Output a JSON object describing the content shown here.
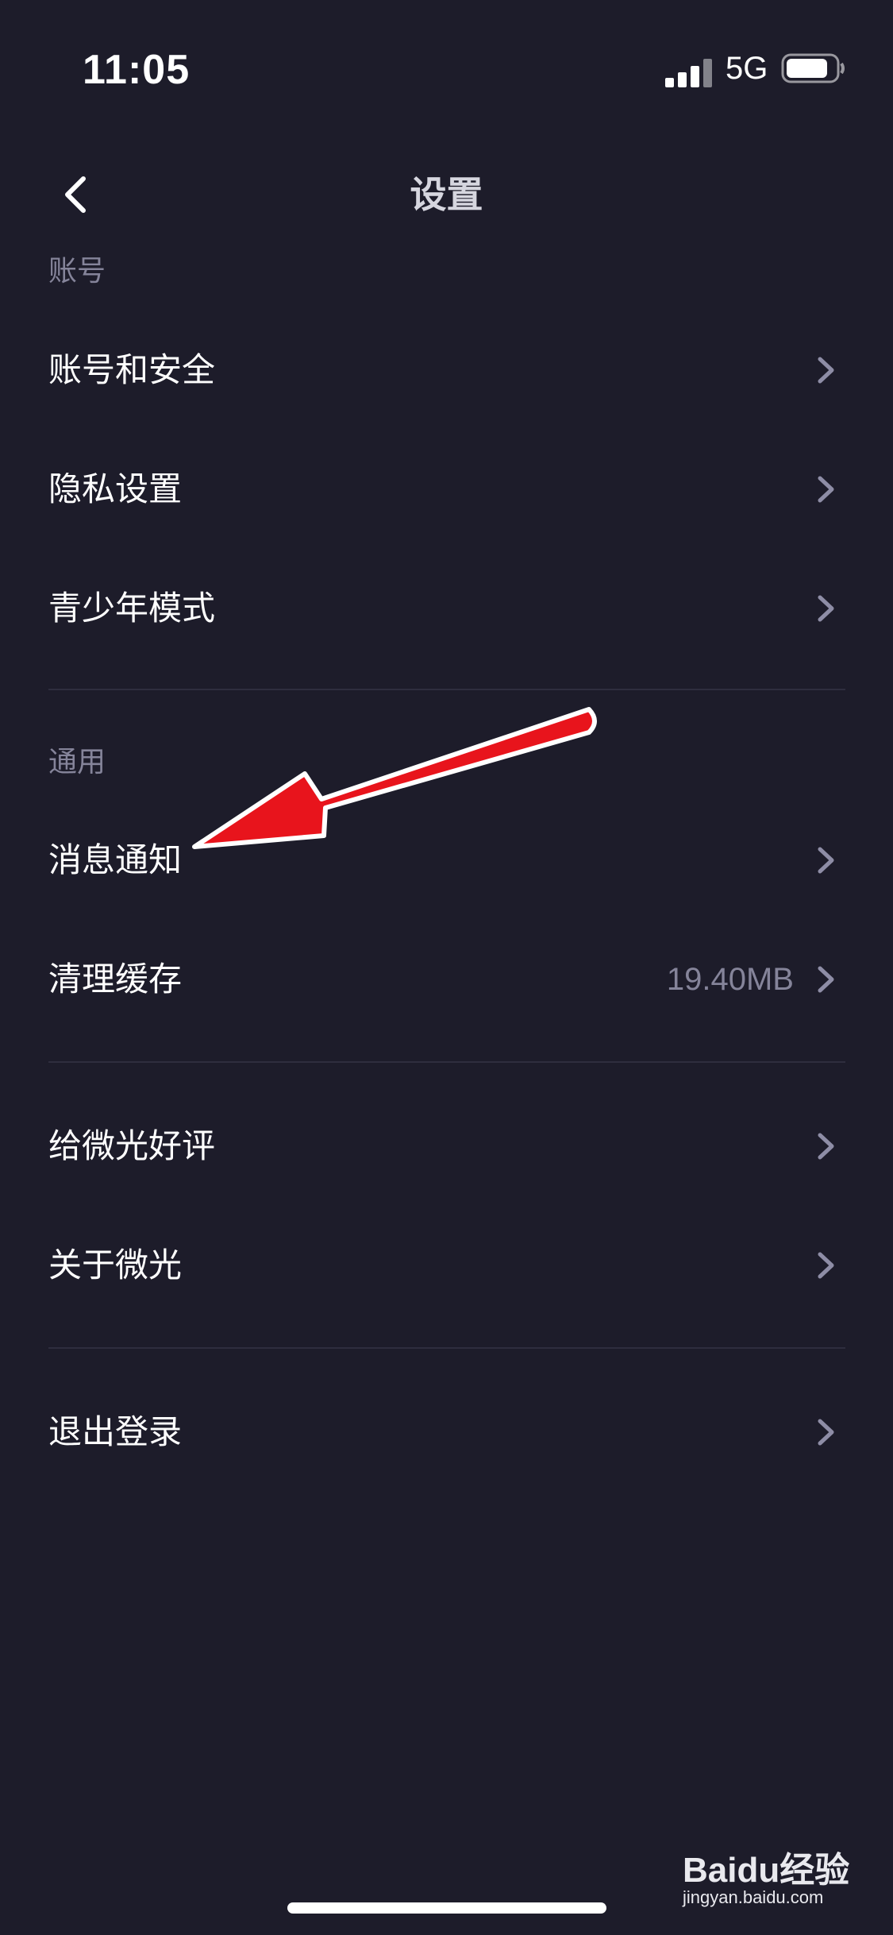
{
  "status_bar": {
    "time": "11:05",
    "network": "5G",
    "battery_level": 0.85
  },
  "nav": {
    "title": "设置",
    "back_icon": "chevron-left-icon"
  },
  "sections": {
    "account": {
      "header": "账号",
      "items": [
        {
          "label": "账号和安全"
        },
        {
          "label": "隐私设置"
        },
        {
          "label": "青少年模式"
        }
      ]
    },
    "general": {
      "header": "通用",
      "items": [
        {
          "label": "消息通知"
        },
        {
          "label": "清理缓存",
          "value": "19.40MB"
        }
      ]
    },
    "about": {
      "items": [
        {
          "label": "给微光好评"
        },
        {
          "label": "关于微光"
        }
      ]
    },
    "logout": {
      "items": [
        {
          "label": "退出登录"
        }
      ]
    }
  },
  "colors": {
    "background": "#1d1c2a",
    "muted_text": "#85849a",
    "chevron": "#8e8da6",
    "annotation_arrow": "#e8141c"
  },
  "watermark": {
    "logo": "Baidu经验",
    "url": "jingyan.baidu.com"
  }
}
